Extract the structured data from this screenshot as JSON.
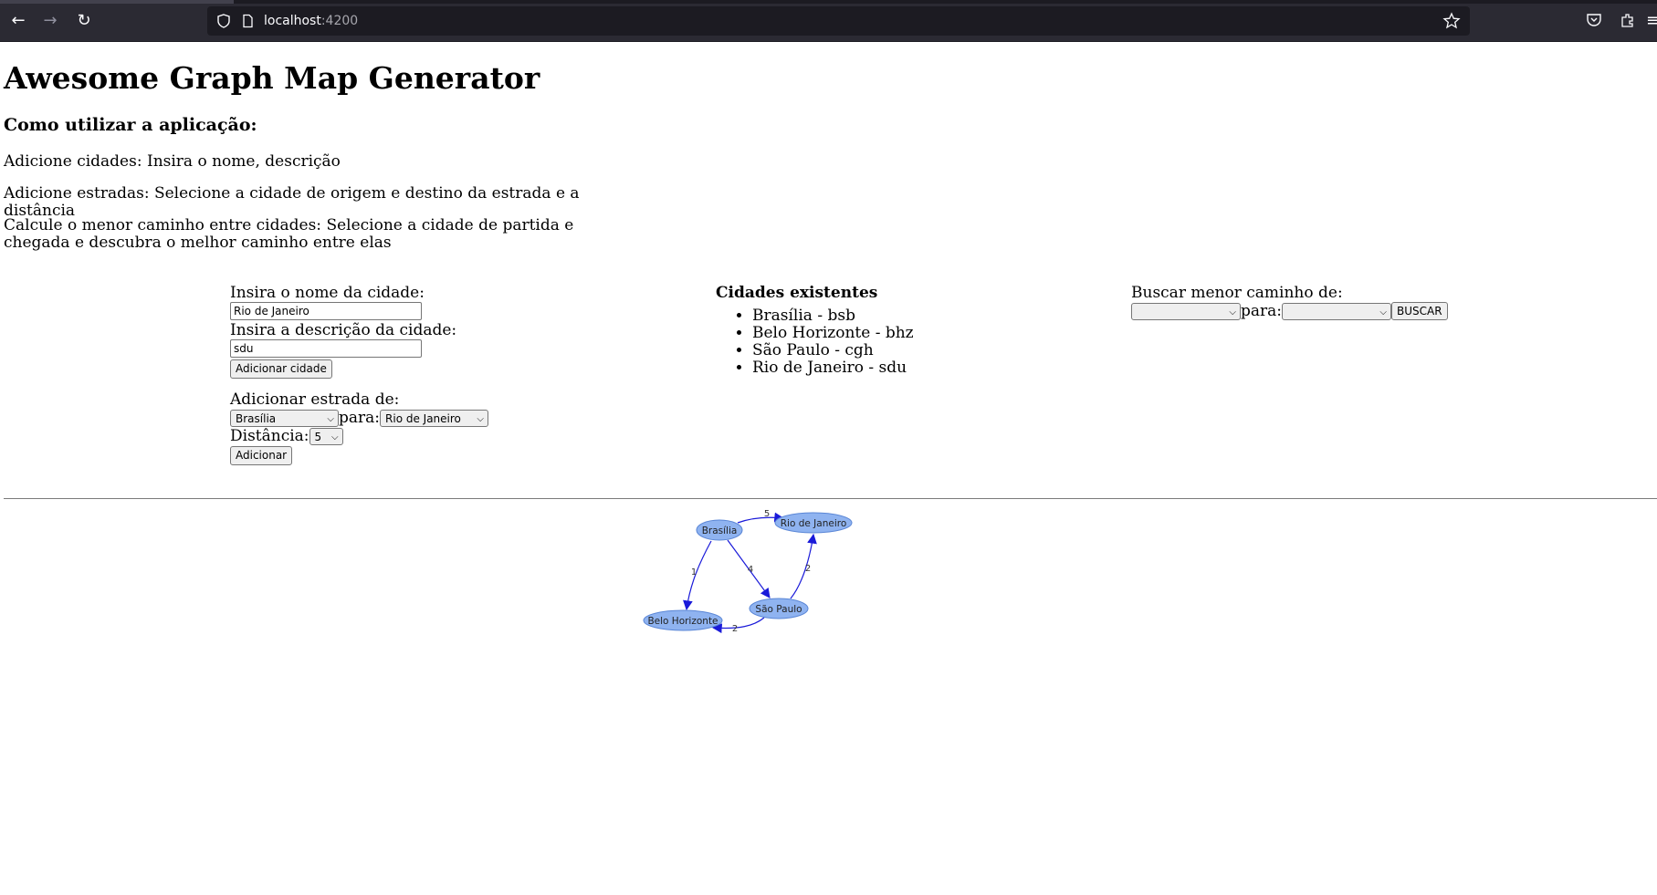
{
  "browser": {
    "url_host": "localhost",
    "url_port": ":4200"
  },
  "page": {
    "title": "Awesome Graph Map Generator",
    "howto_heading": "Como utilizar a aplicação:",
    "steps": [
      "Adicione cidades: Insira o nome, descrição",
      "Adicione estradas: Selecione a cidade de origem e destino da estrada e a distância",
      "Calcule o menor caminho entre cidades: Selecione a cidade de partida e chegada e descubra o melhor caminho entre elas"
    ]
  },
  "add_city": {
    "name_label": "Insira o nome da cidade:",
    "name_value": "Rio de Janeiro",
    "desc_label": "Insira a descrição da cidade:",
    "desc_value": "sdu",
    "button": "Adicionar cidade"
  },
  "add_road": {
    "from_label": "Adicionar estrada de:",
    "from_value": "Brasília",
    "to_label": "para:",
    "to_value": "Rio de Janeiro",
    "distance_label": "Distância:",
    "distance_value": "5",
    "button": "Adicionar"
  },
  "cities": {
    "heading": "Cidades existentes",
    "items": [
      "Brasília - bsb",
      "Belo Horizonte - bhz",
      "São Paulo - cgh",
      "Rio de Janeiro - sdu"
    ]
  },
  "shortest_path": {
    "from_label": "Buscar menor caminho de:",
    "from_value": "",
    "to_label": "para:",
    "to_value": "",
    "button": "BUSCAR"
  },
  "graph": {
    "node_fill": "#8fb3f0",
    "node_stroke": "#5a86d6",
    "edge_color": "#1a1ad9",
    "nodes": [
      {
        "id": "bsb",
        "label": "Brasília"
      },
      {
        "id": "sdu",
        "label": "Rio de Janeiro"
      },
      {
        "id": "bhz",
        "label": "Belo Horizonte"
      },
      {
        "id": "cgh",
        "label": "São Paulo"
      }
    ],
    "edges": [
      {
        "from": "bsb",
        "to": "sdu",
        "label": "5"
      },
      {
        "from": "bsb",
        "to": "bhz",
        "label": "1"
      },
      {
        "from": "bsb",
        "to": "cgh",
        "label": "4"
      },
      {
        "from": "cgh",
        "to": "sdu",
        "label": "2"
      },
      {
        "from": "cgh",
        "to": "bhz",
        "label": "2"
      }
    ]
  }
}
